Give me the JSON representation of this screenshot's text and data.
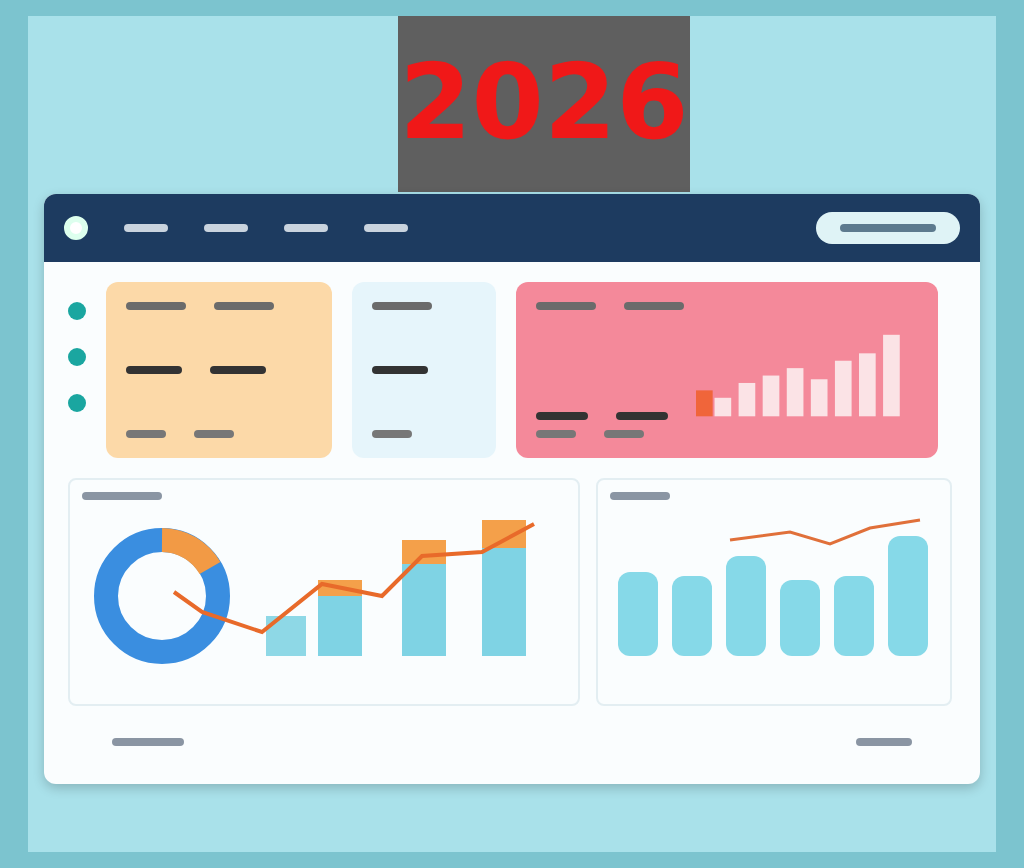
{
  "banner": {
    "text": "2026"
  },
  "stat_cards": [
    {
      "color": "#fcd9a8",
      "kind": "pair"
    },
    {
      "color": "#e6f5fb",
      "kind": "single"
    },
    {
      "color": "#f4899a",
      "kind": "chart"
    }
  ]
}
